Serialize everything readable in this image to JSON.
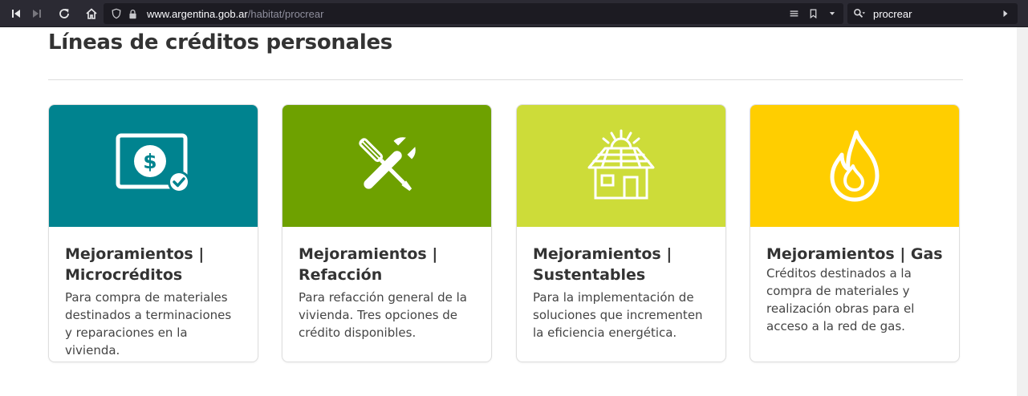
{
  "browser": {
    "url_host": "www.argentina.gob.ar",
    "url_path": "/habitat/procrear",
    "search_value": "procrear"
  },
  "page": {
    "title": "Líneas de créditos personales"
  },
  "cards": [
    {
      "title": "Mejoramientos | Microcréditos",
      "description": "Para compra de materiales destinados a terminaciones y reparaciones en la vivienda.",
      "color": "#00838f",
      "icon": "money-check-icon"
    },
    {
      "title": "Mejoramientos | Refacción",
      "description": "Para refacción general de la vivienda. Tres opciones de crédito disponibles.",
      "color": "#6ea100",
      "icon": "tools-icon"
    },
    {
      "title": "Mejoramientos | Sustentables",
      "description": "Para la implementación de soluciones que incrementen la eficiencia energética.",
      "color": "#cddc39",
      "icon": "solar-house-icon"
    },
    {
      "title": "Mejoramientos | Gas",
      "description": "Créditos destinados a la compra de materiales y realización obras para el acceso a la red de gas.",
      "color": "#ffce00",
      "icon": "flame-icon"
    }
  ]
}
